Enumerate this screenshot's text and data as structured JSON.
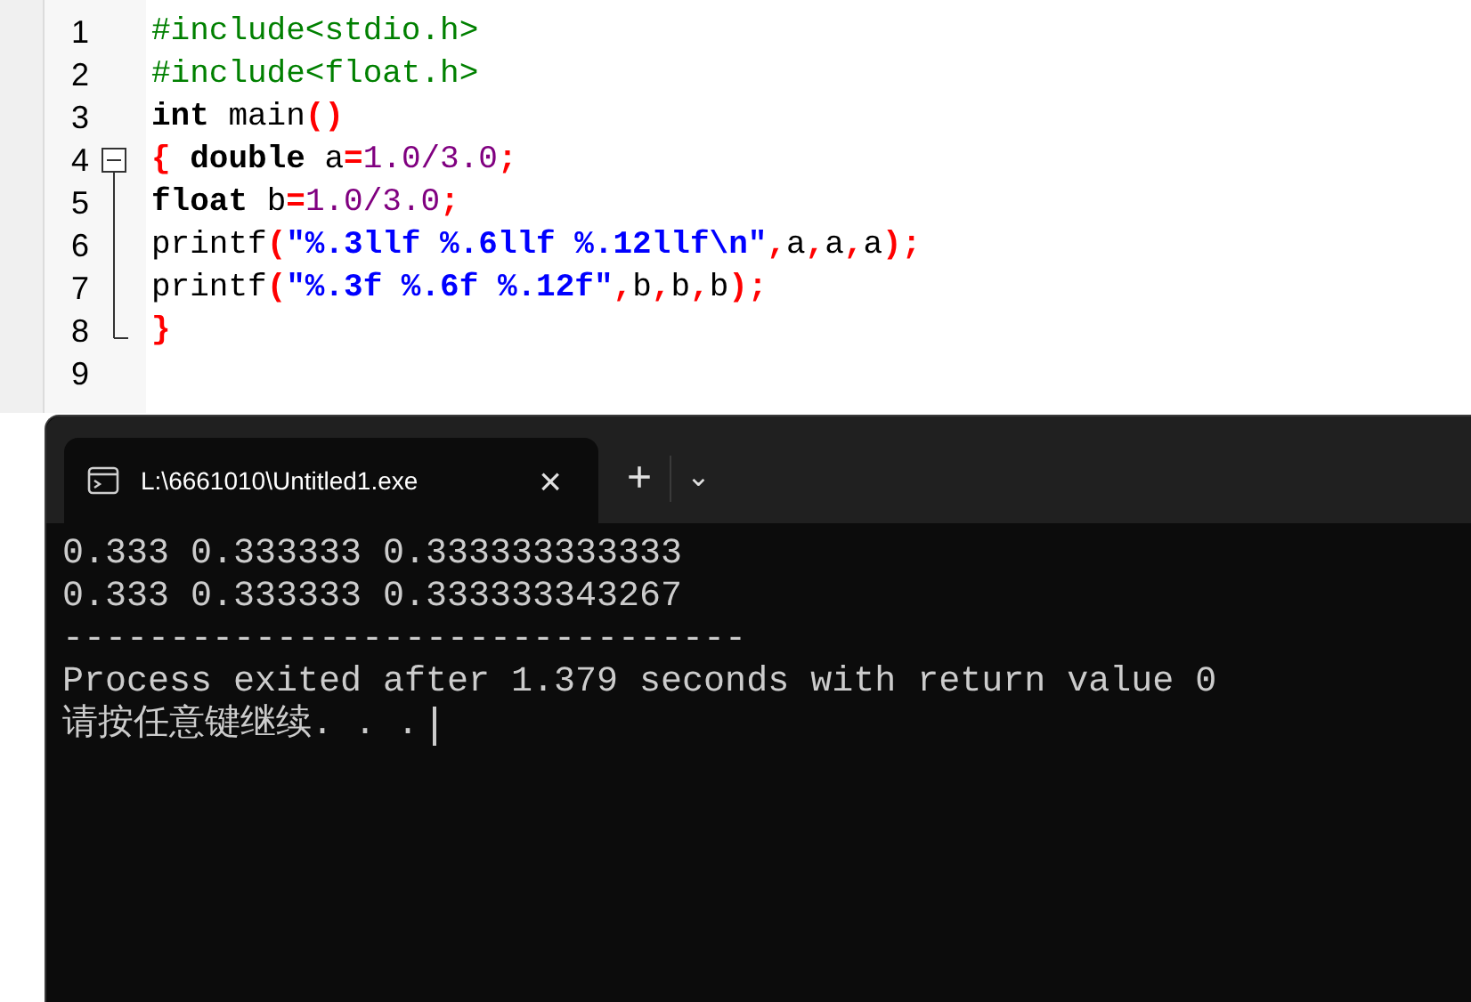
{
  "editor": {
    "lines": [
      {
        "number": "1",
        "tokens": [
          {
            "kind": "pre",
            "text": "#include<stdio.h>"
          }
        ]
      },
      {
        "number": "2",
        "tokens": [
          {
            "kind": "pre",
            "text": "#include<float.h>"
          }
        ]
      },
      {
        "number": "3",
        "tokens": [
          {
            "kind": "kw",
            "text": "int"
          },
          {
            "kind": "plain",
            "text": " main"
          },
          {
            "kind": "sym",
            "text": "()"
          }
        ]
      },
      {
        "number": "4",
        "fold_start": true,
        "tokens": [
          {
            "kind": "sym",
            "text": "{ "
          },
          {
            "kind": "kw",
            "text": "double"
          },
          {
            "kind": "plain",
            "text": " a"
          },
          {
            "kind": "sym",
            "text": "="
          },
          {
            "kind": "num",
            "text": "1.0/3.0"
          },
          {
            "kind": "sym",
            "text": ";"
          }
        ]
      },
      {
        "number": "5",
        "tokens": [
          {
            "kind": "kw",
            "text": "float"
          },
          {
            "kind": "plain",
            "text": " b"
          },
          {
            "kind": "sym",
            "text": "="
          },
          {
            "kind": "num",
            "text": "1.0/3.0"
          },
          {
            "kind": "sym",
            "text": ";"
          }
        ]
      },
      {
        "number": "6",
        "tokens": [
          {
            "kind": "plain",
            "text": "printf"
          },
          {
            "kind": "sym",
            "text": "("
          },
          {
            "kind": "str",
            "text": "\"%.3llf %.6llf %.12llf\\n\""
          },
          {
            "kind": "sym",
            "text": ","
          },
          {
            "kind": "plain",
            "text": "a"
          },
          {
            "kind": "sym",
            "text": ","
          },
          {
            "kind": "plain",
            "text": "a"
          },
          {
            "kind": "sym",
            "text": ","
          },
          {
            "kind": "plain",
            "text": "a"
          },
          {
            "kind": "sym",
            "text": ");"
          }
        ]
      },
      {
        "number": "7",
        "tokens": [
          {
            "kind": "plain",
            "text": "printf"
          },
          {
            "kind": "sym",
            "text": "("
          },
          {
            "kind": "str",
            "text": "\"%.3f %.6f %.12f\""
          },
          {
            "kind": "sym",
            "text": ","
          },
          {
            "kind": "plain",
            "text": "b"
          },
          {
            "kind": "sym",
            "text": ","
          },
          {
            "kind": "plain",
            "text": "b"
          },
          {
            "kind": "sym",
            "text": ","
          },
          {
            "kind": "plain",
            "text": "b"
          },
          {
            "kind": "sym",
            "text": ");"
          }
        ]
      },
      {
        "number": "8",
        "fold_end": true,
        "tokens": [
          {
            "kind": "sym",
            "text": "}"
          }
        ]
      },
      {
        "number": "9"
      }
    ]
  },
  "terminal": {
    "tab": {
      "title": "L:\\6661010\\Untitled1.exe",
      "close": "×",
      "selected": true
    },
    "new_tab": "+",
    "dropdown": "⌄",
    "output": [
      "0.333 0.333333 0.333333333333",
      "0.333 0.333333 0.333333343267",
      "--------------------------------",
      "Process exited after 1.379 seconds with return value 0",
      "请按任意键继续. . ."
    ]
  }
}
